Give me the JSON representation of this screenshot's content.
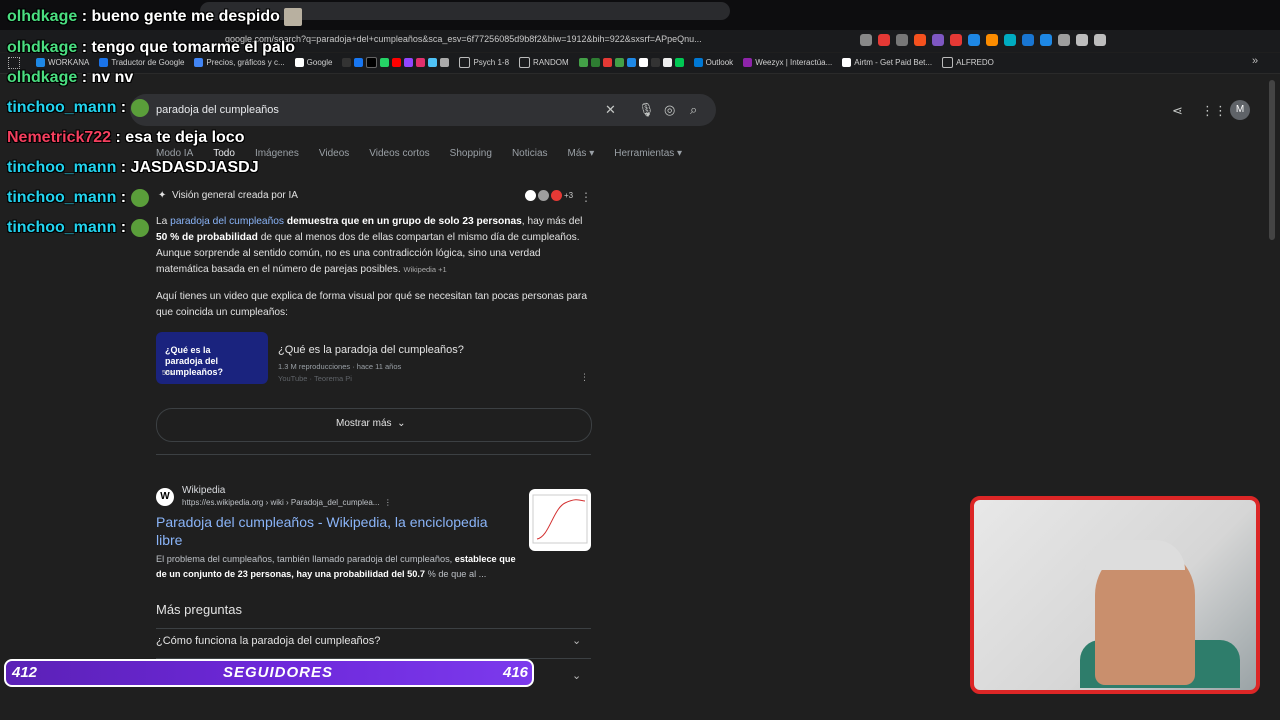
{
  "browser": {
    "url": "google.com/search?q=paradoja+del+cumpleaños&sca_esv=6f77256085d9b8f2&biw=1912&bih=922&sxsrf=APpeQnu...",
    "bookmarks": [
      "WORKANA",
      "Traductor de Google",
      "Precios, gráficos y c...",
      "Google",
      "Psych 1-8",
      "RANDOM",
      "Outlook",
      "Weezyx | Interactúa...",
      "Airtm - Get Paid Bet...",
      "ALFREDO"
    ]
  },
  "search": {
    "query": "paradoja del cumpleaños",
    "avatar": "M",
    "tabs": [
      "Modo IA",
      "Todo",
      "Imágenes",
      "Videos",
      "Videos cortos",
      "Shopping",
      "Noticias",
      "Más",
      "Herramientas"
    ]
  },
  "ai_overview": {
    "title": "Visión general creada por IA",
    "source_count": "+3",
    "p1_a": "La ",
    "p1_link": "paradoja del cumpleaños",
    "p1_b": " demuestra que en un grupo de solo 23 personas",
    "p1_c": ", hay más del ",
    "p1_d": "50 % de probabilidad",
    "p1_e": " de que al menos dos de ellas compartan el mismo día de cumpleaños",
    "p1_f": ". Aunque sorprende al sentido común, no es una contradicción lógica, sino una verdad matemática basada en el número de parejas posibles.",
    "p1_chip": "Wikipedia +1",
    "p2": "Aquí tienes un video que explica de forma visual por qué se necesitan tan pocas personas para que coincida un cumpleaños:",
    "video_thumb_text": "¿Qué es la paradoja del cumpleaños?",
    "video_duration": "55s",
    "video_title": "¿Qué es la paradoja del cumpleaños?",
    "video_meta": "1.3 M reproducciones · hace 11 años",
    "video_source": "YouTube · Teorema Pi",
    "show_more": "Mostrar más"
  },
  "result": {
    "site": "Wikipedia",
    "url": "https://es.wikipedia.org › wiki › Paradoja_del_cumplea...",
    "title": "Paradoja del cumpleaños - Wikipedia, la enciclopedia libre",
    "snippet_a": "El problema del cumpleaños, también llamado paradoja del cumpleaños, ",
    "snippet_b": "establece que de un conjunto de 23 personas, hay una probabilidad del 50.7",
    "snippet_c": " % de que al ..."
  },
  "questions": {
    "heading": "Más preguntas",
    "q1": "¿Cómo funciona la paradoja del cumpleaños?"
  },
  "chat": [
    {
      "user": "olhdkage",
      "msg": ": bueno gente me despido"
    },
    {
      "user": "olhdkage",
      "msg": ": tengo que tomarme el palo"
    },
    {
      "user": "olhdkage",
      "msg": ": nv nv"
    },
    {
      "user": "tinchoo_mann",
      "msg": ":"
    },
    {
      "user": "Nemetrick722",
      "msg": ": esa te deja loco"
    },
    {
      "user": "tinchoo_mann",
      "msg": ": JASDASDJASDJ"
    },
    {
      "user": "tinchoo_mann",
      "msg": ":"
    },
    {
      "user": "tinchoo_mann",
      "msg": ":"
    }
  ],
  "followers": {
    "current": "412",
    "label": "SEGUIDORES",
    "goal": "416",
    "progress": 0.99
  },
  "colors": {
    "link": "#8ab4f8",
    "follower_bar": "#6d28d9",
    "cam_border": "#dc2626"
  }
}
